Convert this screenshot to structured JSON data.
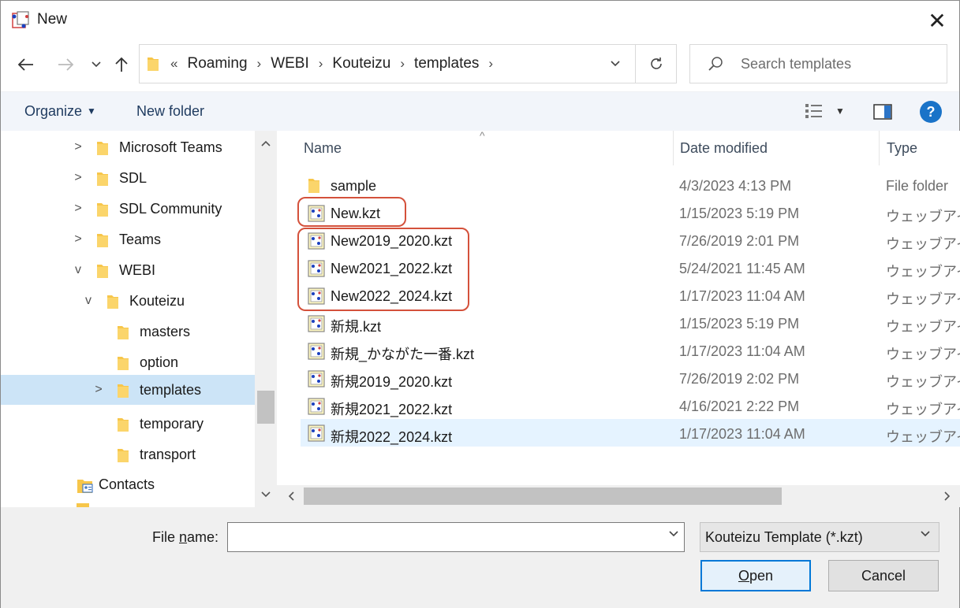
{
  "window": {
    "title": "New",
    "close_glyph": "✕"
  },
  "nav": {
    "back_icon": "arrow-left-icon",
    "forward_icon": "arrow-right-icon",
    "recent_icon": "chevron-down-icon",
    "up_icon": "arrow-up-icon",
    "overflow": "«",
    "breadcrumbs": [
      "Roaming",
      "WEBI",
      "Kouteizu",
      "templates"
    ],
    "search_placeholder": "Search templates"
  },
  "toolbar": {
    "organize_label": "Organize",
    "new_folder_label": "New folder",
    "help_label": "?"
  },
  "tree": {
    "items": [
      {
        "label": "Microsoft Teams",
        "chevron": ">",
        "depth": 0
      },
      {
        "label": "SDL",
        "chevron": ">",
        "depth": 0
      },
      {
        "label": "SDL Community",
        "chevron": ">",
        "depth": 0
      },
      {
        "label": "Teams",
        "chevron": ">",
        "depth": 0
      },
      {
        "label": "WEBI",
        "chevron": "v",
        "depth": 0
      },
      {
        "label": "Kouteizu",
        "chevron": "v",
        "depth": 1
      },
      {
        "label": "masters",
        "chevron": "",
        "depth": 2
      },
      {
        "label": "option",
        "chevron": "",
        "depth": 2
      },
      {
        "label": "templates",
        "chevron": ">",
        "depth": 2,
        "selected": true
      },
      {
        "label": "temporary",
        "chevron": "",
        "depth": 2
      },
      {
        "label": "transport",
        "chevron": "",
        "depth": 2
      },
      {
        "label": "Contacts",
        "chevron": "",
        "depth": -1
      }
    ]
  },
  "list": {
    "columns": {
      "name": "Name",
      "date": "Date modified",
      "type": "Type"
    },
    "rows": [
      {
        "name": "sample",
        "date": "4/3/2023 4:13 PM",
        "type": "File folder",
        "kind": "folder"
      },
      {
        "name": "New.kzt",
        "date": "1/15/2023 5:19 PM",
        "type": "ウェッブアイ",
        "kind": "file"
      },
      {
        "name": "New2019_2020.kzt",
        "date": "7/26/2019 2:01 PM",
        "type": "ウェッブアイ",
        "kind": "file"
      },
      {
        "name": "New2021_2022.kzt",
        "date": "5/24/2021 11:45 AM",
        "type": "ウェッブアイ",
        "kind": "file"
      },
      {
        "name": "New2022_2024.kzt",
        "date": "1/17/2023 11:04 AM",
        "type": "ウェッブアイ",
        "kind": "file"
      },
      {
        "name": "新規.kzt",
        "date": "1/15/2023 5:19 PM",
        "type": "ウェッブアイ",
        "kind": "file"
      },
      {
        "name": "新規_かながた一番.kzt",
        "date": "1/17/2023 11:04 AM",
        "type": "ウェッブアイ",
        "kind": "file"
      },
      {
        "name": "新規2019_2020.kzt",
        "date": "7/26/2019 2:02 PM",
        "type": "ウェッブアイ",
        "kind": "file"
      },
      {
        "name": "新規2021_2022.kzt",
        "date": "4/16/2021 2:22 PM",
        "type": "ウェッブアイ",
        "kind": "file"
      },
      {
        "name": "新規2022_2024.kzt",
        "date": "1/17/2023 11:04 AM",
        "type": "ウェッブアイ",
        "kind": "file",
        "highlighted": true
      }
    ]
  },
  "footer": {
    "file_name_label_pre": "File ",
    "file_name_label_u": "n",
    "file_name_label_post": "ame:",
    "file_name_value": "",
    "file_type_selected": "Kouteizu Template (*.kzt)",
    "open_u": "O",
    "open_rest": "pen",
    "cancel_label": "Cancel"
  },
  "colors": {
    "accent": "#0078d7",
    "selection": "#cce4f7",
    "hover": "#e5f3ff",
    "annotation_red": "#d4513b",
    "folder_yellow": "#f7c64a"
  }
}
